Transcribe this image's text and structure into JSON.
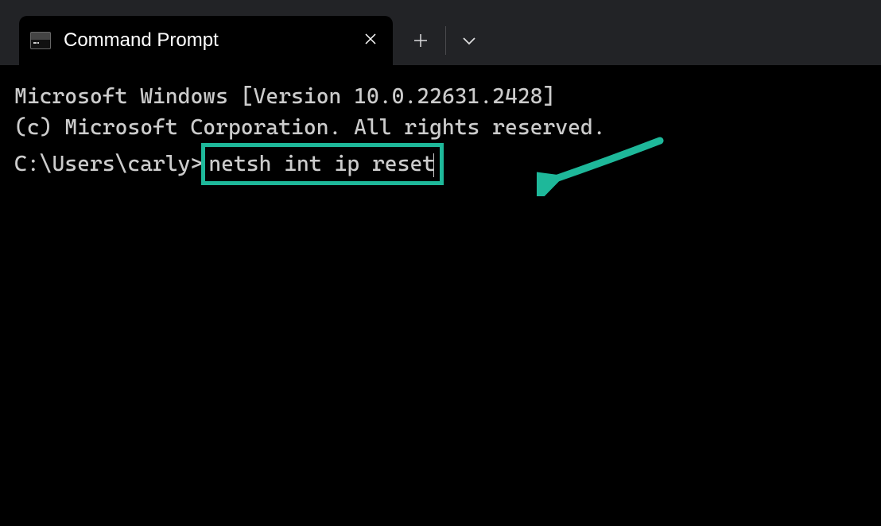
{
  "tab": {
    "title": "Command Prompt"
  },
  "terminal": {
    "line1": "Microsoft Windows [Version 10.0.22631.2428]",
    "line2": "(c) Microsoft Corporation. All rights reserved.",
    "blank": "",
    "prompt": "C:\\Users\\carly>",
    "command": "netsh int ip reset"
  },
  "annotation": {
    "highlight_color": "#1eb89a"
  }
}
